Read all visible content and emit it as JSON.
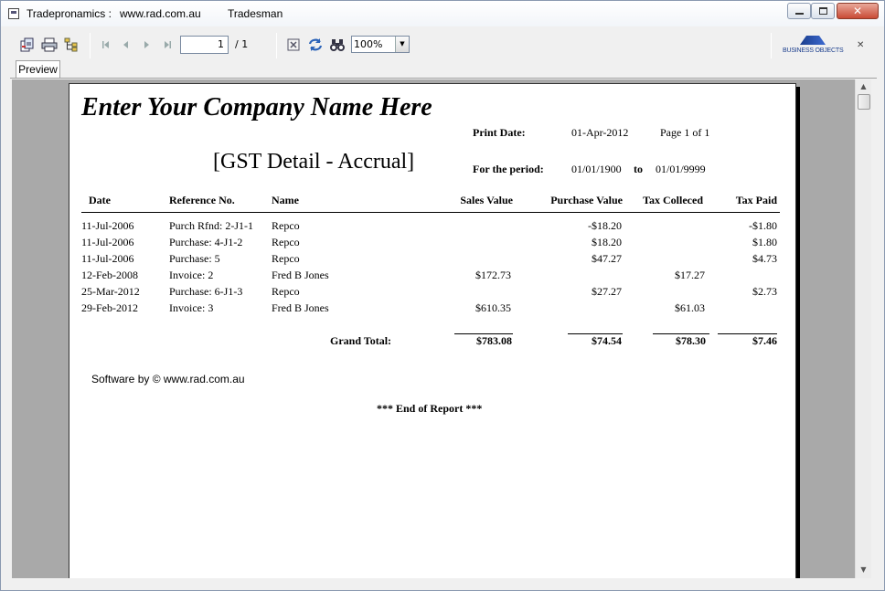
{
  "window": {
    "title_app": "Tradepronamics :",
    "title_site": "www.rad.com.au",
    "title_user": "Tradesman"
  },
  "toolbar": {
    "page_current": "1",
    "page_total": "/ 1",
    "zoom": "100%",
    "brand": "BUSINESS OBJECTS"
  },
  "tab": {
    "label": "Preview"
  },
  "report": {
    "company": "Enter Your Company Name Here",
    "title": "[GST Detail - Accrual]",
    "print_date_label": "Print Date:",
    "print_date": "01-Apr-2012",
    "page_info": "Page 1 of 1",
    "period_label": "For the period:",
    "period_from": "01/01/1900",
    "period_to_label": "to",
    "period_to": "01/01/9999",
    "columns": [
      "Date",
      "Reference No.",
      "Name",
      "Sales Value",
      "Purchase Value",
      "Tax Colleced",
      "Tax Paid"
    ],
    "rows": [
      {
        "date": "11-Jul-2006",
        "ref": "Purch Rfnd: 2-J1-1",
        "name": "Repco",
        "sales": "",
        "purchase": "-$18.20",
        "tax_collected": "",
        "tax_paid": "-$1.80"
      },
      {
        "date": "11-Jul-2006",
        "ref": "Purchase: 4-J1-2",
        "name": "Repco",
        "sales": "",
        "purchase": "$18.20",
        "tax_collected": "",
        "tax_paid": "$1.80"
      },
      {
        "date": "11-Jul-2006",
        "ref": "Purchase: 5",
        "name": "Repco",
        "sales": "",
        "purchase": "$47.27",
        "tax_collected": "",
        "tax_paid": "$4.73"
      },
      {
        "date": "12-Feb-2008",
        "ref": "Invoice: 2",
        "name": "Fred B Jones",
        "sales": "$172.73",
        "purchase": "",
        "tax_collected": "$17.27",
        "tax_paid": ""
      },
      {
        "date": "25-Mar-2012",
        "ref": "Purchase: 6-J1-3",
        "name": "Repco",
        "sales": "",
        "purchase": "$27.27",
        "tax_collected": "",
        "tax_paid": "$2.73"
      },
      {
        "date": "29-Feb-2012",
        "ref": "Invoice: 3",
        "name": "Fred B Jones",
        "sales": "$610.35",
        "purchase": "",
        "tax_collected": "$61.03",
        "tax_paid": ""
      }
    ],
    "grand_total_label": "Grand Total:",
    "totals": {
      "sales": "$783.08",
      "purchase": "$74.54",
      "tax_collected": "$78.30",
      "tax_paid": "$7.46"
    },
    "software_by": "Software by ©  www.rad.com.au",
    "end_of_report": "*** End of Report ***"
  }
}
